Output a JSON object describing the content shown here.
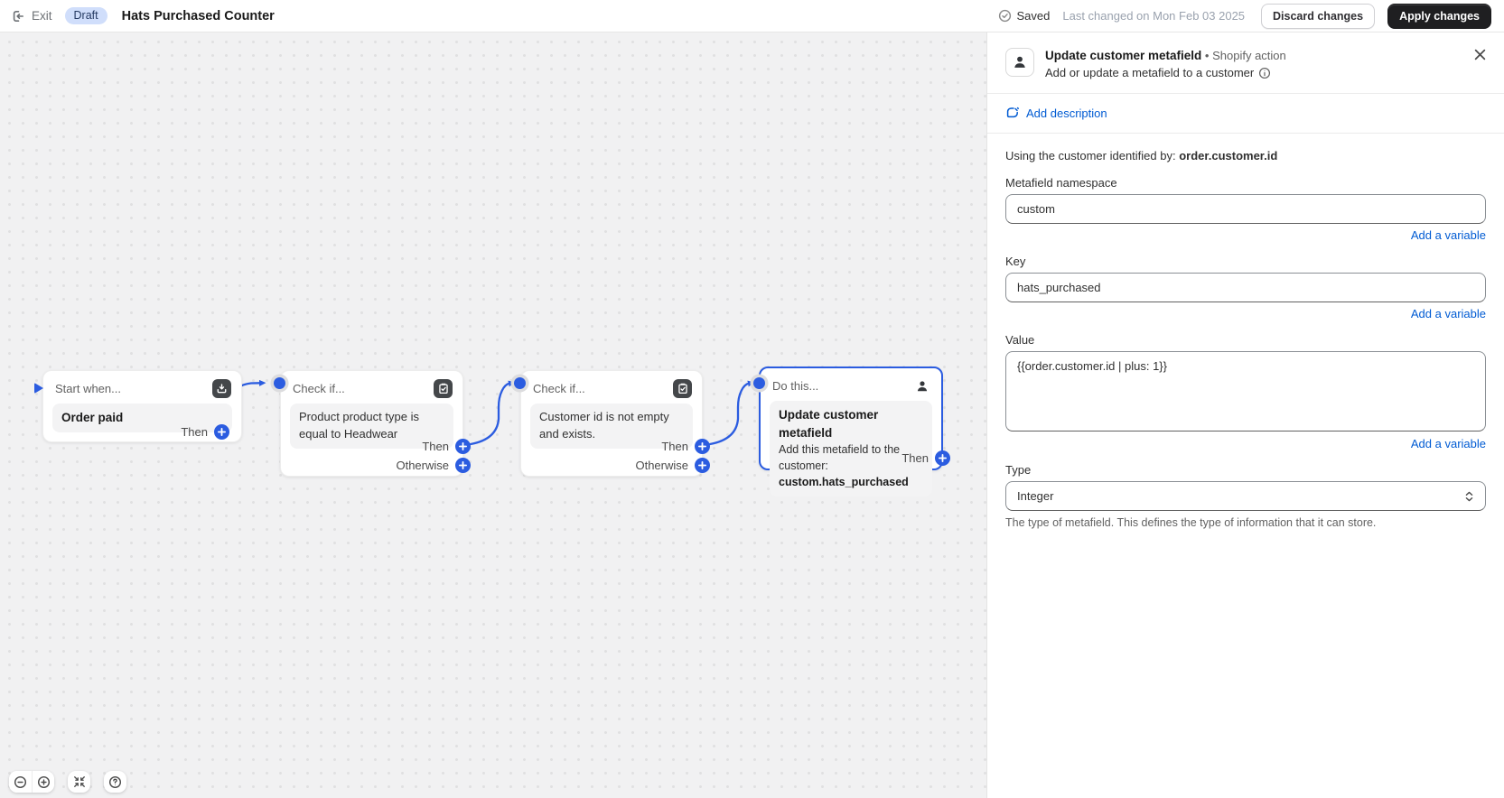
{
  "topbar": {
    "exit_label": "Exit",
    "status_badge": "Draft",
    "title": "Hats Purchased Counter",
    "saved_label": "Saved",
    "last_changed": "Last changed on Mon Feb 03 2025",
    "discard_label": "Discard changes",
    "apply_label": "Apply changes"
  },
  "canvas": {
    "nodes": [
      {
        "kind": "trigger",
        "header": "Start when...",
        "title": "Order paid",
        "then_label": "Then",
        "icon": "inbox-arrow-down-icon"
      },
      {
        "kind": "condition",
        "header": "Check if...",
        "body": "Product product type is equal to Headwear",
        "then_label": "Then",
        "otherwise_label": "Otherwise",
        "icon": "clipboard-check-icon"
      },
      {
        "kind": "condition",
        "header": "Check if...",
        "body": "Customer id is not empty and exists.",
        "then_label": "Then",
        "otherwise_label": "Otherwise",
        "icon": "clipboard-check-icon"
      },
      {
        "kind": "action",
        "header": "Do this...",
        "title": "Update customer metafield",
        "body": "Add this metafield to the customer:",
        "target": "custom.hats_purchased",
        "then_label": "Then",
        "icon": "person-icon",
        "selected": true
      }
    ],
    "controls": {
      "zoom_out": "zoom-out-icon",
      "zoom_in": "zoom-in-icon",
      "fit": "fit-view-icon",
      "help": "help-icon"
    }
  },
  "panel": {
    "title": "Update customer metafield",
    "bullet": "•",
    "meta": "Shopify action",
    "description": "Add or update a metafield to a customer",
    "add_description_label": "Add description",
    "context_prefix": "Using the customer identified by: ",
    "context_value": "order.customer.id",
    "fields": {
      "namespace": {
        "label": "Metafield namespace",
        "value": "custom",
        "add_variable": "Add a variable"
      },
      "key": {
        "label": "Key",
        "value": "hats_purchased",
        "add_variable": "Add a variable"
      },
      "value": {
        "label": "Value",
        "value": "{{order.customer.id | plus: 1}}",
        "add_variable": "Add a variable"
      },
      "type": {
        "label": "Type",
        "value": "Integer",
        "help": "The type of metafield. This defines the type of information that it can store."
      }
    }
  },
  "colors": {
    "accent_blue": "#2b5ce0",
    "link_blue": "#005bd3",
    "badge_bg": "#d0defb",
    "badge_text": "#253a62",
    "apply_btn_bg": "#1f1f21",
    "canvas_bg": "#f1f1f2",
    "node_icon_bg": "#44474a"
  }
}
